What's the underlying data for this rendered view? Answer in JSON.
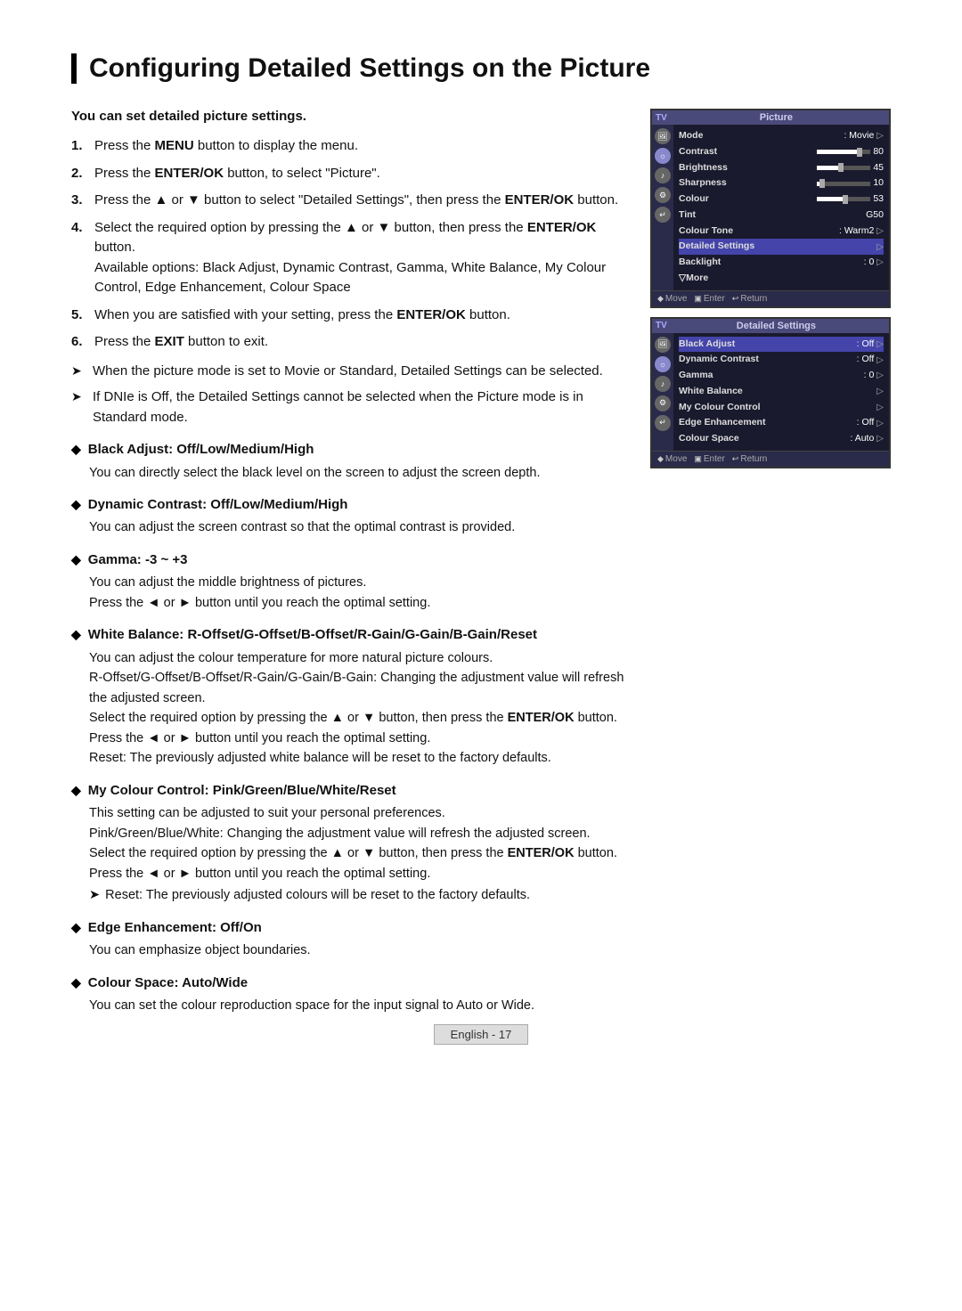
{
  "page": {
    "title": "Configuring Detailed Settings on the Picture",
    "footer": "English - 17"
  },
  "intro": {
    "bold_text": "You can set detailed picture settings."
  },
  "steps": [
    {
      "num": "1.",
      "text": "Press the ",
      "bold": "MENU",
      "text2": " button to display the menu."
    },
    {
      "num": "2.",
      "text": "Press the ",
      "bold": "ENTER/OK",
      "text2": " button, to select \"Picture\"."
    },
    {
      "num": "3.",
      "text": "Press the ▲ or ▼ button to select \"Detailed Settings\", then press the ",
      "bold": "ENTER/OK",
      "text2": " button."
    },
    {
      "num": "4.",
      "text": "Select the required option by pressing the ▲ or ▼ button, then press the ",
      "bold": "ENTER/OK",
      "text2": " button.\nAvailable options: Black Adjust, Dynamic Contrast, Gamma, White Balance, My Colour Control, Edge Enhancement, Colour Space"
    },
    {
      "num": "5.",
      "text": "When you are satisfied with your setting, press the ",
      "bold": "ENTER/OK",
      "text2": " button."
    },
    {
      "num": "6.",
      "text": "Press the ",
      "bold": "EXIT",
      "text2": " button to exit."
    }
  ],
  "arrow_notes": [
    {
      "sym": "➤",
      "text": "When the picture mode is set to Movie or Standard, Detailed Settings can be selected."
    },
    {
      "sym": "➤",
      "text": "If DNIe is Off, the Detailed Settings cannot be selected when the Picture mode is in Standard mode."
    }
  ],
  "bullets": [
    {
      "header": "Black Adjust: Off/Low/Medium/High",
      "body": "You can directly select the black level on the screen to adjust the screen depth."
    },
    {
      "header": "Dynamic Contrast: Off/Low/Medium/High",
      "body": "You can adjust the screen contrast so that the optimal contrast is provided."
    },
    {
      "header": "Gamma: -3 ~ +3",
      "body": "You can adjust the middle brightness of pictures.\nPress the ◄ or ► button until you reach the optimal setting."
    },
    {
      "header": "White Balance: R-Offset/G-Offset/B-Offset/R-Gain/G-Gain/B-Gain/Reset",
      "body": "You can adjust the colour temperature for more natural picture colours.\nR-Offset/G-Offset/B-Offset/R-Gain/G-Gain/B-Gain: Changing the adjustment value will refresh the adjusted screen.\nSelect the required option by pressing the ▲ or ▼ button, then press the ENTER/OK button.\nPress the ◄ or ► button until you reach the optimal setting.\nReset: The previously adjusted white balance will be reset to the factory defaults.",
      "has_enterok_bold": true
    },
    {
      "header": "My Colour Control: Pink/Green/Blue/White/Reset",
      "body": "This setting can be adjusted to suit your personal preferences.\nPink/Green/Blue/White: Changing the adjustment value will refresh the adjusted screen.\nSelect the required option by pressing the ▲ or ▼ button, then press the ENTER/OK button.\nPress the ◄ or ► button until you reach the optimal setting.",
      "has_enterok_bold": true,
      "extra_arrow": "➤  Reset: The previously adjusted colours will be reset to the factory defaults."
    },
    {
      "header": "Edge Enhancement: Off/On",
      "body": "You can emphasize object boundaries."
    },
    {
      "header": "Colour Space: Auto/Wide",
      "body": "You can set the colour reproduction space for the input signal to Auto or Wide."
    }
  ],
  "tv_screen1": {
    "title": "Picture",
    "rows": [
      {
        "label": "Mode",
        "value": ": Movie",
        "has_arrow": true,
        "slider": false,
        "highlighted": false
      },
      {
        "label": "Contrast",
        "value": "",
        "has_arrow": false,
        "slider": true,
        "slider_pct": 80,
        "val_num": "80",
        "highlighted": false
      },
      {
        "label": "Brightness",
        "value": "",
        "has_arrow": false,
        "slider": true,
        "slider_pct": 45,
        "val_num": "45",
        "highlighted": false
      },
      {
        "label": "Sharpness",
        "value": "",
        "has_arrow": false,
        "slider": true,
        "slider_pct": 10,
        "val_num": "10",
        "highlighted": false
      },
      {
        "label": "Colour",
        "value": "",
        "has_arrow": false,
        "slider": true,
        "slider_pct": 53,
        "val_num": "53",
        "highlighted": false
      },
      {
        "label": "Tint",
        "value": "G50",
        "has_arrow": false,
        "slider": false,
        "highlighted": false
      },
      {
        "label": "Colour Tone",
        "value": ": Warm2",
        "has_arrow": true,
        "slider": false,
        "highlighted": false
      },
      {
        "label": "Detailed Settings",
        "value": "",
        "has_arrow": true,
        "slider": false,
        "highlighted": true
      },
      {
        "label": "Backlight",
        "value": ": 0",
        "has_arrow": true,
        "slider": false,
        "highlighted": false
      },
      {
        "label": "▽More",
        "value": "",
        "has_arrow": false,
        "slider": false,
        "highlighted": false
      }
    ],
    "footer_items": [
      {
        "icon": "◆",
        "label": "Move"
      },
      {
        "icon": "▣",
        "label": "Enter"
      },
      {
        "icon": "↩",
        "label": "Return"
      }
    ]
  },
  "tv_screen2": {
    "title": "Detailed Settings",
    "rows": [
      {
        "label": "Black Adjust",
        "value": ": Off",
        "has_arrow": true,
        "highlighted": true
      },
      {
        "label": "Dynamic Contrast",
        "value": ": Off",
        "has_arrow": true,
        "highlighted": false
      },
      {
        "label": "Gamma",
        "value": ": 0",
        "has_arrow": true,
        "highlighted": false
      },
      {
        "label": "White Balance",
        "value": "",
        "has_arrow": true,
        "highlighted": false
      },
      {
        "label": "My Colour Control",
        "value": "",
        "has_arrow": true,
        "highlighted": false
      },
      {
        "label": "Edge Enhancement",
        "value": ": Off",
        "has_arrow": true,
        "highlighted": false
      },
      {
        "label": "Colour Space",
        "value": ": Auto",
        "has_arrow": true,
        "highlighted": false
      }
    ],
    "footer_items": [
      {
        "icon": "◆",
        "label": "Move"
      },
      {
        "icon": "▣",
        "label": "Enter"
      },
      {
        "icon": "↩",
        "label": "Return"
      }
    ]
  }
}
